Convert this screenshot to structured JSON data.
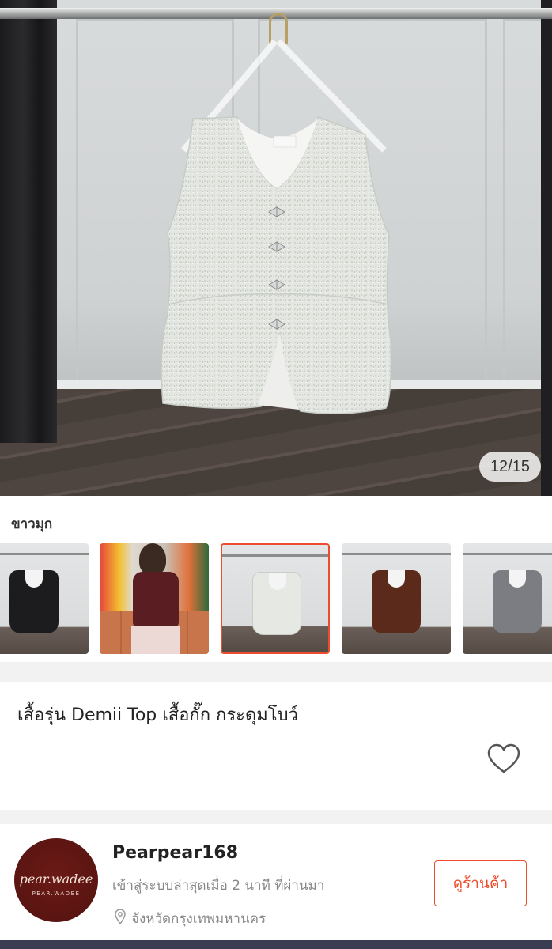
{
  "gallery": {
    "counter": "12/15"
  },
  "variant": {
    "label": "ขาวมุก",
    "thumbnails": [
      {
        "name": "black",
        "color": "#1c1c1e"
      },
      {
        "name": "maroon-model",
        "color": "#5a1d22"
      },
      {
        "name": "pearl-white",
        "color": "#e6e8e4",
        "selected": true
      },
      {
        "name": "brown",
        "color": "#5b2a1a"
      },
      {
        "name": "grey",
        "color": "#7b7d82"
      }
    ]
  },
  "product": {
    "title": "เสื้อรุ่น Demii Top เสื้อกั๊ก กระดุมโบว์"
  },
  "shop": {
    "avatar_text": "pear.wadee",
    "avatar_subtext": "PEAR.WADEE",
    "name": "Pearpear168",
    "status": "เข้าสู่ระบบล่าสุดเมื่อ 2 นาที ที่ผ่านมา",
    "location": "จังหวัดกรุงเทพมหานคร",
    "view_shop_label": "ดูร้านค้า"
  },
  "colors": {
    "accent": "#ee4d2d"
  },
  "icons": {
    "heart": "heart-icon",
    "location": "location-pin-icon"
  }
}
